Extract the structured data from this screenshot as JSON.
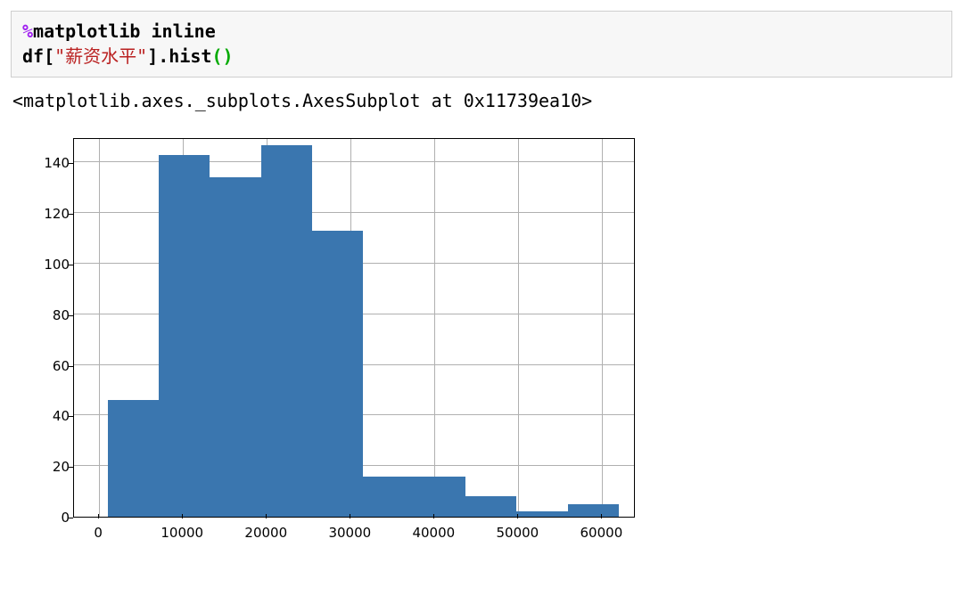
{
  "code": {
    "pct": "%",
    "magic": "matplotlib inline",
    "line2a": "df[",
    "q1": "\"",
    "col": "薪资水平",
    "q2": "\"",
    "line2b": "].hist",
    "paren": "()"
  },
  "output_repr": "<matplotlib.axes._subplots.AxesSubplot at 0x11739ea10>",
  "chart_data": {
    "type": "bar",
    "title": "",
    "xlabel": "",
    "ylabel": "",
    "xlim": [
      -3000,
      64000
    ],
    "ylim": [
      0,
      150
    ],
    "xticks": [
      0,
      10000,
      20000,
      30000,
      40000,
      50000,
      60000
    ],
    "yticks": [
      0,
      20,
      40,
      60,
      80,
      100,
      120,
      140
    ],
    "bin_edges": [
      1000,
      7100,
      13200,
      19300,
      25400,
      31500,
      37600,
      43700,
      49800,
      55900,
      62000
    ],
    "values": [
      46,
      143,
      134,
      147,
      113,
      16,
      16,
      8,
      2,
      5
    ]
  }
}
